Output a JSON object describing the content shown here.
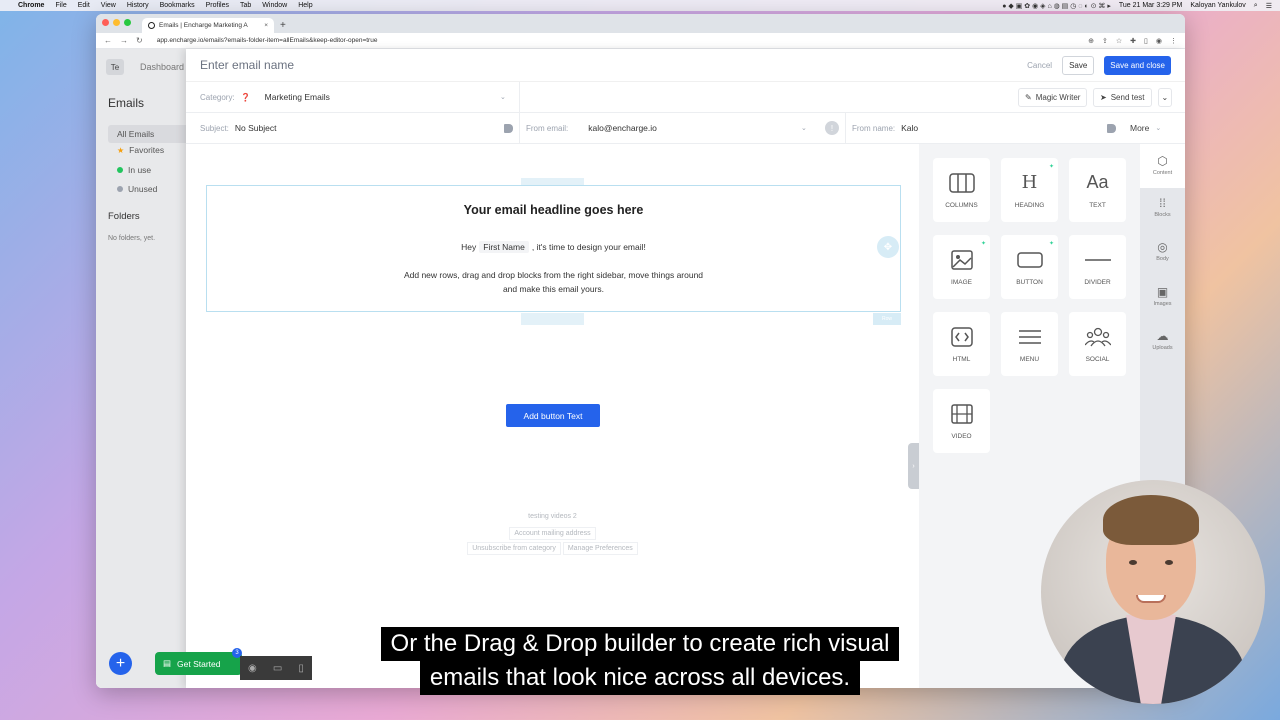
{
  "os_menubar": {
    "app": "Chrome",
    "menus": [
      "File",
      "Edit",
      "View",
      "History",
      "Bookmarks",
      "Profiles",
      "Tab",
      "Window",
      "Help"
    ],
    "datetime": "Tue 21 Mar 3:29 PM",
    "user": "Kaloyan Yankulov"
  },
  "browser": {
    "tab_title": "Emails | Encharge Marketing A",
    "url": "app.encharge.io/emails?emails-folder-item=allEmails&keep-editor-open=true"
  },
  "leftnav": {
    "workspace_initials": "Te",
    "dashboard_label": "Dashboard",
    "section_title": "Emails",
    "items": [
      {
        "label": "All Emails",
        "color": ""
      },
      {
        "label": "Favorites",
        "color": "#f59e0b"
      },
      {
        "label": "In use",
        "color": "#22c55e"
      },
      {
        "label": "Unused",
        "color": "#9ca3af"
      }
    ],
    "folders_title": "Folders",
    "no_folders": "No folders, yet."
  },
  "editor": {
    "name_placeholder": "Enter email name",
    "cancel": "Cancel",
    "save": "Save",
    "save_close": "Save and close",
    "category_label": "Category:",
    "category_value": "Marketing Emails",
    "magic_writer": "Magic Writer",
    "send_test": "Send test",
    "subject_label": "Subject:",
    "subject_value": "No Subject",
    "from_email_label": "From email:",
    "from_email_value": "kalo@encharge.io",
    "from_name_label": "From name:",
    "from_name_value": "Kalo",
    "more": "More"
  },
  "email": {
    "headline": "Your email headline goes here",
    "hey": "Hey",
    "merge_tag": "First Name",
    "hey_rest": ", it's time to design your email!",
    "instructions_1": "Add new rows, drag and drop blocks from the right sidebar, move things around",
    "instructions_2": "and make this email yours.",
    "button": "Add button Text",
    "row_tag": "Row",
    "footer_company": "testing videos 2",
    "footer_address": "Account mailing address",
    "footer_unsub": "Unsubscribe from category",
    "footer_prefs": "Manage Preferences"
  },
  "blocks": [
    {
      "label": "COLUMNS",
      "icon": "columns-icon",
      "glyph": "▥"
    },
    {
      "label": "HEADING",
      "icon": "heading-icon",
      "glyph": "H"
    },
    {
      "label": "TEXT",
      "icon": "text-icon",
      "glyph": "Aa"
    },
    {
      "label": "IMAGE",
      "icon": "image-icon",
      "glyph": "🖼"
    },
    {
      "label": "BUTTON",
      "icon": "button-icon",
      "glyph": "▭"
    },
    {
      "label": "DIVIDER",
      "icon": "divider-icon",
      "glyph": "—"
    },
    {
      "label": "HTML",
      "icon": "html-icon",
      "glyph": "‹›"
    },
    {
      "label": "MENU",
      "icon": "menu-icon",
      "glyph": "☰"
    },
    {
      "label": "SOCIAL",
      "icon": "social-icon",
      "glyph": "⚇"
    },
    {
      "label": "VIDEO",
      "icon": "video-icon",
      "glyph": "▦"
    }
  ],
  "rail": [
    {
      "label": "Content",
      "glyph": "⬡"
    },
    {
      "label": "Blocks",
      "glyph": "⁞⁞"
    },
    {
      "label": "Body",
      "glyph": "◎"
    },
    {
      "label": "Images",
      "glyph": "▣"
    },
    {
      "label": "Uploads",
      "glyph": "☁"
    }
  ],
  "bottom": {
    "get_started": "Get Started",
    "badge": "3"
  },
  "caption": {
    "line1": "Or the Drag & Drop builder to create rich visual",
    "line2": "emails that look nice across all devices."
  }
}
